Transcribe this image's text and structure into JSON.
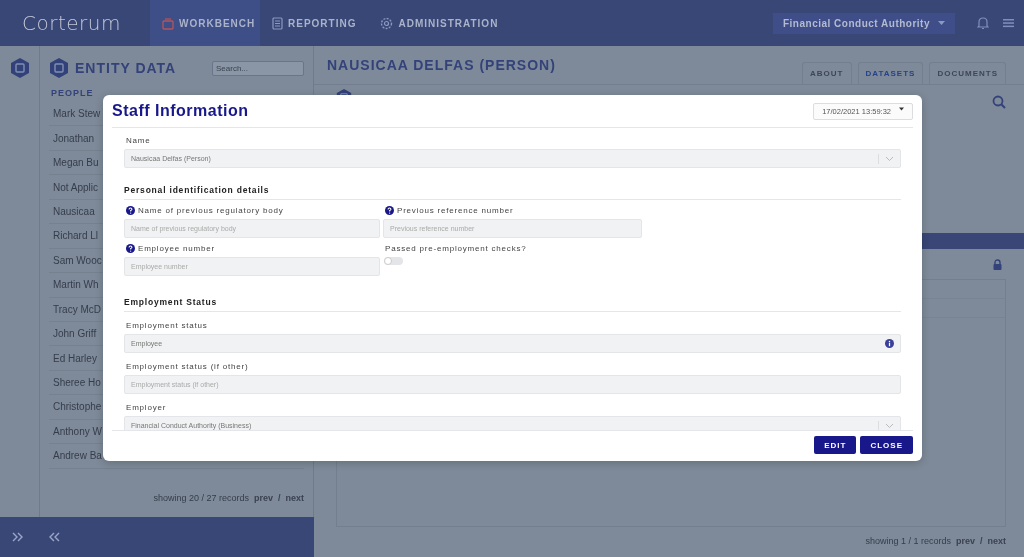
{
  "header": {
    "logo": "Corterum",
    "nav": [
      {
        "label": "WORKBENCH",
        "kind": "workbench",
        "selected": true
      },
      {
        "label": "REPORTING",
        "kind": "reporting",
        "selected": false
      },
      {
        "label": "ADMINISTRATION",
        "kind": "administration",
        "selected": false
      }
    ],
    "organisation": "Financial Conduct Authority"
  },
  "sidebar": {
    "title": "ENTITY DATA",
    "search_placeholder": "Search...",
    "group": "PEOPLE",
    "items": [
      "Mark Stew",
      "Jonathan",
      "Megan Bu",
      "Not Applic",
      "Nausicaa",
      "Richard Ll",
      "Sam Wooc",
      "Martin Wh",
      "Tracy McD",
      "John Griff",
      "Ed Harley",
      "Sheree Ho",
      "Christophe",
      "Anthony W",
      "Andrew Ba"
    ],
    "footer": {
      "count": "showing 20 / 27 records",
      "prev": "prev",
      "separator": "/",
      "next": "next"
    }
  },
  "main": {
    "title": "NAUSICAA DELFAS (PERSON)",
    "tabs": [
      {
        "label": "ABOUT",
        "selected": false
      },
      {
        "label": "DATASETS",
        "selected": true
      },
      {
        "label": "DOCUMENTS",
        "selected": false
      }
    ],
    "footer": {
      "count": "showing 1 / 1 records",
      "prev": "prev",
      "separator": "/",
      "next": "next"
    }
  },
  "dialog": {
    "title": "Staff Information",
    "version": "17/02/2021 13:59:32",
    "name_field": {
      "label": "Name",
      "value": "Nausicaa Delfas (Person)"
    },
    "sections": [
      {
        "title": "Personal identification details",
        "kind": "grid",
        "fields": [
          {
            "kind": "text",
            "label": "Name of previous regulatory body",
            "placeholder": "Name of previous regulatory body",
            "help": true
          },
          {
            "kind": "text",
            "label": "Previous reference number",
            "placeholder": "Previous reference number",
            "help": true
          },
          {
            "kind": "text",
            "label": "Employee number",
            "placeholder": "Employee number",
            "help": true
          },
          {
            "kind": "toggle",
            "label": "Passed pre-employment checks?",
            "on": false
          }
        ]
      },
      {
        "title": "Employment Status",
        "kind": "stack",
        "fields": [
          {
            "kind": "text",
            "label": "Employment status",
            "value": "Employee",
            "info": true
          },
          {
            "kind": "text",
            "label": "Employment status (if other)",
            "placeholder": "Employment status (if other)"
          },
          {
            "kind": "select",
            "label": "Employer",
            "value": "Financial Conduct Authority (Business)"
          }
        ]
      }
    ],
    "buttons": [
      "EDIT",
      "CLOSE"
    ]
  }
}
